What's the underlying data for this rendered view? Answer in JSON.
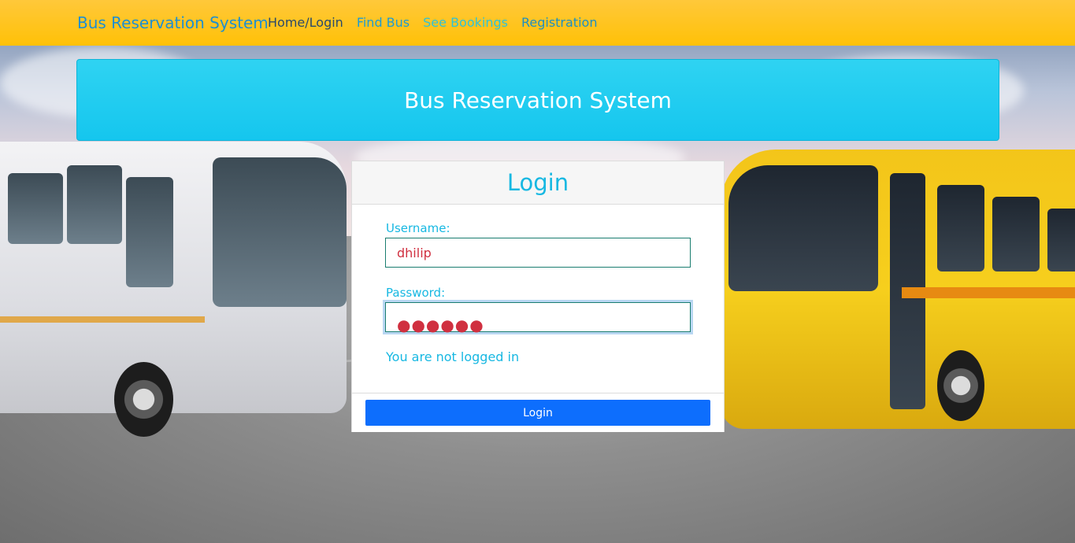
{
  "navbar": {
    "brand": "Bus Reservation System",
    "links": [
      {
        "label": "Home/Login",
        "color": "#2a4a6a"
      },
      {
        "label": "Find Bus",
        "color": "#1e9bd0"
      },
      {
        "label": "See Bookings",
        "color": "#2fc2d6"
      },
      {
        "label": "Registration",
        "color": "#1e8fc0"
      }
    ]
  },
  "banner": {
    "title": "Bus Reservation System"
  },
  "login": {
    "title": "Login",
    "username_label": "Username:",
    "username_value": "dhilip",
    "password_label": "Password:",
    "password_masked": "●●●●●●",
    "status": "You are not logged in",
    "button_label": "Login"
  },
  "colors": {
    "navbar": "#ffc107",
    "banner": "#17c7ee",
    "accent_text": "#17b8e2",
    "button": "#0d6efd"
  }
}
